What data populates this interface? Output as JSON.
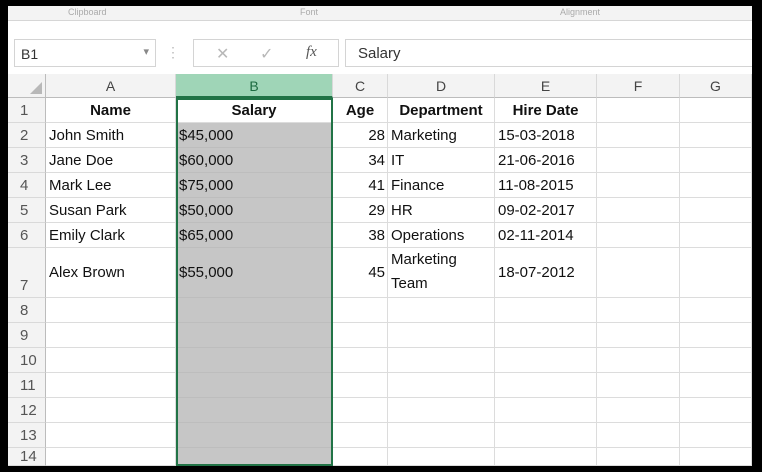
{
  "ribbon": {
    "groups": [
      "Clipboard",
      "Font",
      "Alignment"
    ]
  },
  "formula_bar": {
    "name_box": "B1",
    "cancel_glyph": "✕",
    "enter_glyph": "✓",
    "fx_glyph": "fx",
    "content": "Salary"
  },
  "columns": [
    "A",
    "B",
    "C",
    "D",
    "E",
    "F",
    "G"
  ],
  "selected_column": "B",
  "rows": [
    {
      "n": "1",
      "A": "Name",
      "B": "Salary",
      "C": "Age",
      "D": "Department",
      "E": "Hire Date"
    },
    {
      "n": "2",
      "A": "John Smith",
      "B": "$45,000",
      "C": "28",
      "D": "Marketing",
      "E": "15-03-2018"
    },
    {
      "n": "3",
      "A": "Jane Doe",
      "B": "$60,000",
      "C": "34",
      "D": "IT",
      "E": "21-06-2016"
    },
    {
      "n": "4",
      "A": "Mark Lee",
      "B": "$75,000",
      "C": "41",
      "D": "Finance",
      "E": "11-08-2015"
    },
    {
      "n": "5",
      "A": "Susan Park",
      "B": "$50,000",
      "C": "29",
      "D": "HR",
      "E": "09-02-2017"
    },
    {
      "n": "6",
      "A": "Emily Clark",
      "B": "$65,000",
      "C": "38",
      "D": "Operations",
      "E": "02-11-2014"
    },
    {
      "n": "7",
      "A": "Alex Brown",
      "B": "$55,000",
      "C": "45",
      "D": "Marketing Team",
      "E": "18-07-2012"
    },
    {
      "n": "8"
    },
    {
      "n": "9"
    },
    {
      "n": "10"
    },
    {
      "n": "11"
    },
    {
      "n": "12"
    },
    {
      "n": "13"
    },
    {
      "n": "14"
    }
  ],
  "colors": {
    "selection_accent": "#217346",
    "selected_header": "#9fd5b7",
    "selected_fill": "#c6c6c6"
  }
}
